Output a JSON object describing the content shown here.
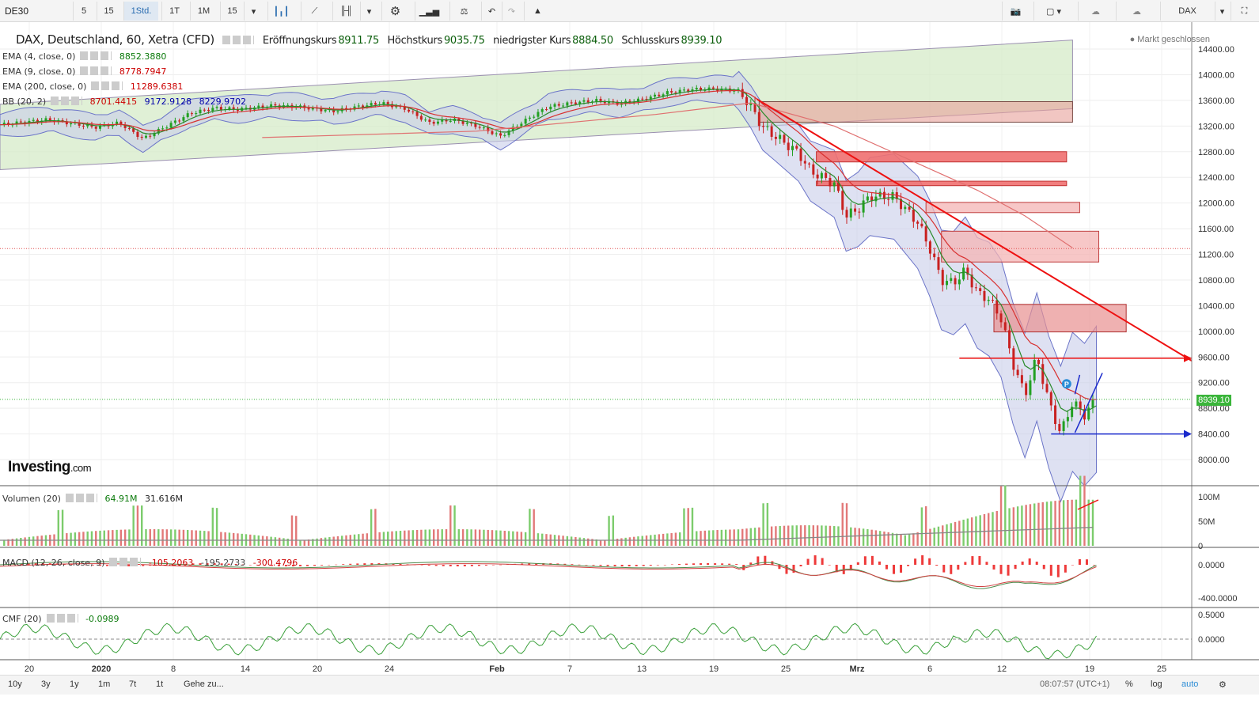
{
  "toolbar": {
    "symbol": "DE30",
    "intervals": [
      "5",
      "15",
      "1Std.",
      "1T",
      "1M",
      "15"
    ],
    "active_interval": "1Std.",
    "symbol_right": "DAX"
  },
  "header": {
    "title": "DAX, Deutschland, 60, Xetra (CFD)",
    "open_label": "Eröffnungskurs",
    "open_value": "8911.75",
    "high_label": "Höchstkurs",
    "high_value": "9035.75",
    "low_label": "niedrigster Kurs",
    "low_value": "8884.50",
    "close_label": "Schlusskurs",
    "close_value": "8939.10",
    "market_status": "Markt geschlossen"
  },
  "indicators": [
    {
      "label": "EMA (4, close, 0)",
      "values": [
        "8852.3880"
      ],
      "color": "#0b7a0b"
    },
    {
      "label": "EMA (9, close, 0)",
      "values": [
        "8778.7947"
      ],
      "color": "#cc0000"
    },
    {
      "label": "EMA (200, close, 0)",
      "values": [
        "11289.6381"
      ],
      "color": "#cc0000"
    },
    {
      "label": "BB (20, 2)",
      "values": [
        "8701.4415",
        "9172.9128",
        "8229.9702"
      ],
      "colors": [
        "#cc0000",
        "#0000aa",
        "#0000aa"
      ]
    }
  ],
  "branding": {
    "name": "Investing",
    "suffix": ".com"
  },
  "chart_data": {
    "type": "candlestick",
    "price_axis": {
      "ticks": [
        14400,
        14000,
        13600,
        13200,
        12800,
        12400,
        12000,
        11600,
        11200,
        10800,
        10400,
        10000,
        9600,
        9200,
        8800,
        8400,
        8000
      ],
      "labels": [
        "14400.00",
        "14000.00",
        "13600.00",
        "13200.00",
        "12800.00",
        "12400.00",
        "12000.00",
        "11600.00",
        "11200.00",
        "10800.00",
        "10400.00",
        "10000.00",
        "9600.00",
        "9200.00",
        "8800.00",
        "8400.00",
        "8000.00"
      ],
      "range": [
        7800,
        14600
      ]
    },
    "last_price": "8939.10",
    "date_axis": [
      "20",
      "2020",
      "8",
      "14",
      "20",
      "24",
      "Feb",
      "7",
      "13",
      "19",
      "25",
      "Mrz",
      "6",
      "12",
      "19",
      "25"
    ],
    "close_path": [
      [
        0,
        13220
      ],
      [
        4,
        13300
      ],
      [
        8,
        13180
      ],
      [
        10,
        13250
      ],
      [
        12,
        13000
      ],
      [
        14,
        13200
      ],
      [
        16,
        13400
      ],
      [
        18,
        13480
      ],
      [
        20,
        13460
      ],
      [
        23,
        13520
      ],
      [
        25,
        13500
      ],
      [
        28,
        13430
      ],
      [
        30,
        13500
      ],
      [
        32,
        13560
      ],
      [
        34,
        13470
      ],
      [
        36,
        13250
      ],
      [
        38,
        13300
      ],
      [
        40,
        13200
      ],
      [
        42,
        13040
      ],
      [
        44,
        13280
      ],
      [
        46,
        13500
      ],
      [
        48,
        13560
      ],
      [
        50,
        13600
      ],
      [
        52,
        13550
      ],
      [
        54,
        13620
      ],
      [
        56,
        13720
      ],
      [
        58,
        13770
      ],
      [
        60,
        13780
      ],
      [
        62,
        13750
      ],
      [
        63,
        13500
      ],
      [
        64,
        13180
      ],
      [
        65,
        13050
      ],
      [
        67,
        12780
      ],
      [
        68,
        12500
      ],
      [
        70,
        12300
      ],
      [
        71,
        11800
      ],
      [
        72,
        11900
      ],
      [
        73,
        12100
      ],
      [
        75,
        12100
      ],
      [
        76,
        11900
      ],
      [
        77,
        11700
      ],
      [
        78,
        11300
      ],
      [
        79,
        10800
      ],
      [
        80,
        10750
      ],
      [
        81,
        10950
      ],
      [
        82,
        10600
      ],
      [
        83,
        10500
      ],
      [
        84,
        10200
      ],
      [
        85,
        9500
      ],
      [
        86,
        9000
      ],
      [
        87,
        9600
      ],
      [
        88,
        8900
      ],
      [
        89,
        8400
      ],
      [
        90,
        8900
      ],
      [
        91,
        8700
      ],
      [
        92,
        8939
      ]
    ],
    "ema200_path": [
      [
        22,
        13020
      ],
      [
        40,
        13120
      ],
      [
        55,
        13380
      ],
      [
        63,
        13560
      ],
      [
        70,
        13200
      ],
      [
        76,
        12700
      ],
      [
        82,
        12200
      ],
      [
        86,
        11800
      ],
      [
        90,
        11300
      ]
    ],
    "zones": [
      {
        "x_range": [
          63.7,
          90
        ],
        "y_range": [
          13260,
          13580
        ],
        "style": "brown"
      },
      {
        "x_range": [
          68.5,
          89.5
        ],
        "y_range": [
          12640,
          12800
        ],
        "style": "red"
      },
      {
        "x_range": [
          68.5,
          89.5
        ],
        "y_range": [
          12270,
          12340
        ],
        "style": "red"
      },
      {
        "x_range": [
          77.7,
          90.6
        ],
        "y_range": [
          11850,
          12010
        ],
        "style": "pink"
      },
      {
        "x_range": [
          79,
          92.2
        ],
        "y_range": [
          11080,
          11560
        ],
        "style": "pink"
      },
      {
        "x_range": [
          83.4,
          94.5
        ],
        "y_range": [
          9990,
          10420
        ],
        "style": "rose"
      }
    ],
    "volume": {
      "label": "Volumen (20)",
      "values": [
        "64.91M",
        "31.616M"
      ],
      "ticks": [
        "100M",
        "50M",
        "0"
      ]
    },
    "macd": {
      "label": "MACD (12, 26, close, 9)",
      "values": [
        "-105.2063",
        "-195.2733",
        "-300.4796"
      ],
      "ticks": [
        "0.0000",
        "-400.0000"
      ]
    },
    "cmf": {
      "label": "CMF (20)",
      "values": [
        "-0.0989"
      ],
      "ticks": [
        "0.5000",
        "0.0000"
      ]
    }
  },
  "bottombar": {
    "ranges": [
      "10y",
      "3y",
      "1y",
      "1m",
      "7t",
      "1t"
    ],
    "goto": "Gehe zu...",
    "time": "08:07:57 (UTC+1)",
    "percent": "%",
    "log": "log",
    "auto": "auto"
  },
  "colors": {
    "up": "#22a022",
    "down": "#c82020",
    "channel": "#d6ebc8",
    "bb_fill": "#c8cdea"
  }
}
